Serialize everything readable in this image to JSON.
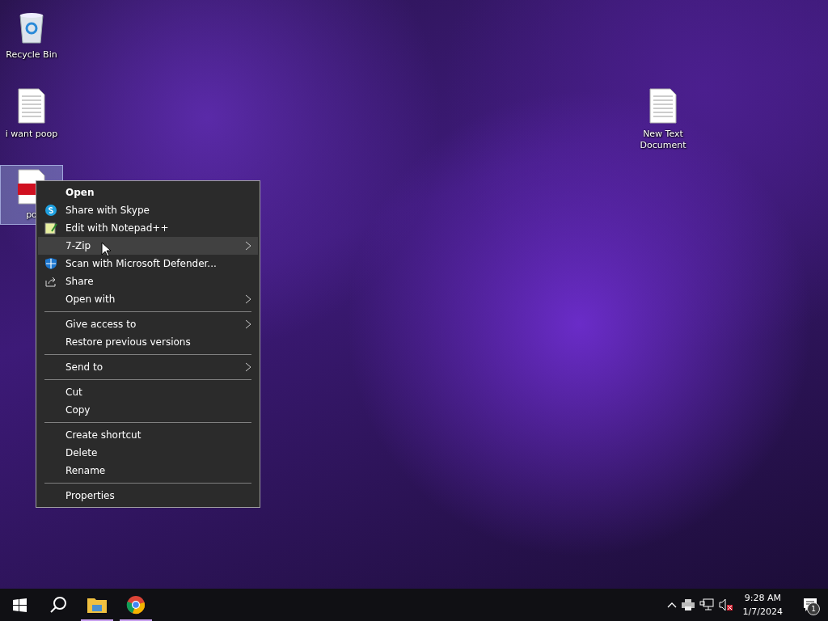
{
  "desktop_icons": [
    {
      "label": "Recycle Bin",
      "kind": "bin",
      "selected": false
    },
    {
      "label": "i want poop",
      "kind": "text",
      "selected": false
    },
    {
      "label": "po",
      "kind": "pdf",
      "selected": true
    },
    {
      "label": "New Text Document",
      "kind": "text",
      "selected": false
    }
  ],
  "context_menu": {
    "groups": [
      [
        {
          "label": "Open",
          "kind": "plain",
          "default": true,
          "submenu": false,
          "selected": false
        },
        {
          "label": "Share with Skype",
          "kind": "skype",
          "default": false,
          "submenu": false,
          "selected": false
        },
        {
          "label": "Edit with Notepad++",
          "kind": "notepad",
          "default": false,
          "submenu": false,
          "selected": false
        },
        {
          "label": "7-Zip",
          "kind": "plain",
          "default": false,
          "submenu": true,
          "selected": true
        },
        {
          "label": "Scan with Microsoft Defender...",
          "kind": "shield",
          "default": false,
          "submenu": false,
          "selected": false
        },
        {
          "label": "Share",
          "kind": "share",
          "default": false,
          "submenu": false,
          "selected": false
        },
        {
          "label": "Open with",
          "kind": "plain",
          "default": false,
          "submenu": true,
          "selected": false
        }
      ],
      [
        {
          "label": "Give access to",
          "kind": "plain",
          "default": false,
          "submenu": true,
          "selected": false
        },
        {
          "label": "Restore previous versions",
          "kind": "plain",
          "default": false,
          "submenu": false,
          "selected": false
        }
      ],
      [
        {
          "label": "Send to",
          "kind": "plain",
          "default": false,
          "submenu": true,
          "selected": false
        }
      ],
      [
        {
          "label": "Cut",
          "kind": "plain",
          "default": false,
          "submenu": false,
          "selected": false
        },
        {
          "label": "Copy",
          "kind": "plain",
          "default": false,
          "submenu": false,
          "selected": false
        }
      ],
      [
        {
          "label": "Create shortcut",
          "kind": "plain",
          "default": false,
          "submenu": false,
          "selected": false
        },
        {
          "label": "Delete",
          "kind": "plain",
          "default": false,
          "submenu": false,
          "selected": false
        },
        {
          "label": "Rename",
          "kind": "plain",
          "default": false,
          "submenu": false,
          "selected": false
        }
      ],
      [
        {
          "label": "Properties",
          "kind": "plain",
          "default": false,
          "submenu": false,
          "selected": false
        }
      ]
    ]
  },
  "taskbar": {
    "apps": [
      {
        "kind": "folder",
        "running": true
      },
      {
        "kind": "browser",
        "running": true
      }
    ],
    "clock": {
      "time": "9:28 AM",
      "date": "1/7/2024"
    },
    "notifications": {
      "count": "1"
    }
  }
}
